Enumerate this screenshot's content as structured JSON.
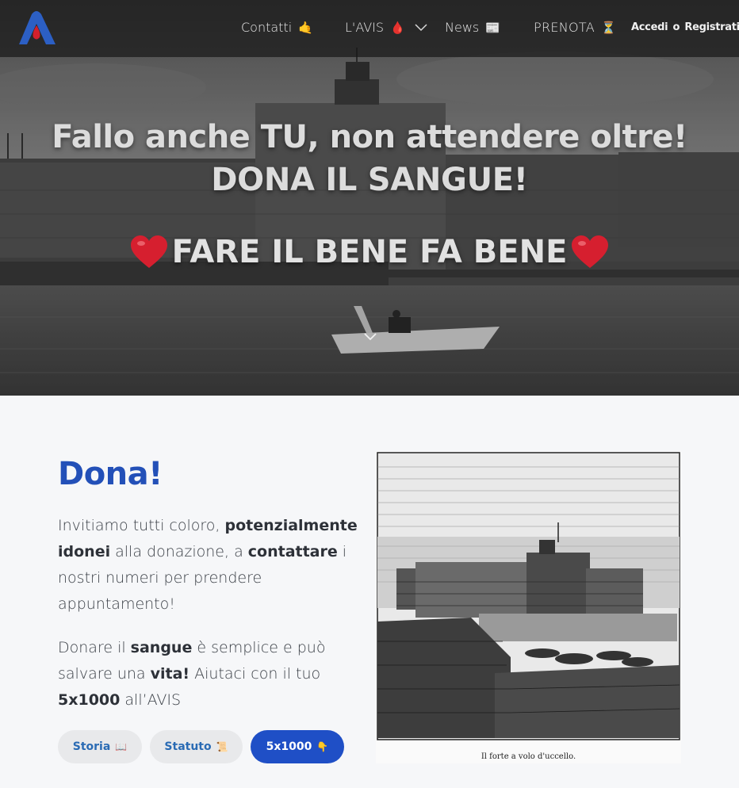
{
  "nav": {
    "contatti": "Contatti",
    "contatti_emoji": "🤙",
    "avis": "L'AVIS",
    "avis_emoji": "🩸",
    "news": "News",
    "news_emoji": "📰",
    "prenota": "PRENOTA",
    "prenota_emoji": "⏳",
    "accedi": "Accedi",
    "o": "o",
    "registrati": "Registrati"
  },
  "hero": {
    "line1": "Fallo anche TU, non attendere oltre!",
    "line2": "DONA IL SANGUE!",
    "line3": "FARE IL BENE FA BENE"
  },
  "content": {
    "title": "Dona!",
    "para1": {
      "t1": "Invitiamo tutti coloro, ",
      "b1": "potenzialmente idonei",
      "t2": " alla donazione, a ",
      "b2": "contattare",
      "t3": " i nostri numeri per prendere appuntamento!"
    },
    "para2": {
      "t1": "Donare il ",
      "b1": "sangue",
      "t2": " è semplice e può salvare una ",
      "b2": "vita!",
      "t3": " Aiutaci con il tuo ",
      "b3": "5x1000",
      "t4": " all’AVIS"
    },
    "buttons": {
      "storia": "Storia",
      "storia_emoji": "📖",
      "statuto": "Statuto",
      "statuto_emoji": "📜",
      "x1000": "5x1000",
      "x1000_emoji": "👇"
    },
    "caption": "Il forte a volo d'uccello."
  },
  "colors": {
    "brand_blue": "#2350b8",
    "button_blue": "#1f4fc6",
    "link_blue": "#2a6bb4",
    "logo_red": "#d41f2c"
  }
}
